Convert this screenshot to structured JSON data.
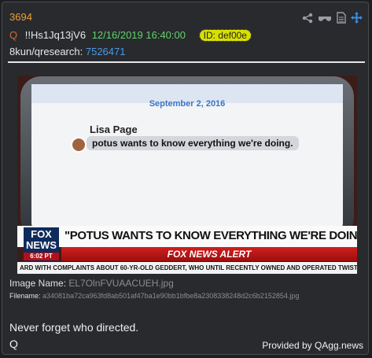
{
  "post": {
    "number": "3694",
    "q_letter": "Q",
    "tripcode": "!!Hs1Jq13jV6",
    "datetime": "12/16/2019 16:40:00",
    "user_id": "ID: def00e",
    "board": "8kun/qresearch:",
    "reference": "7526471"
  },
  "toolbar": {
    "icons": [
      "share-icon",
      "glasses-icon",
      "document-icon",
      "move-icon"
    ]
  },
  "image": {
    "phone_date": "September 2, 2016",
    "sender": "Lisa Page",
    "message": "potus wants to know everything we're doing.",
    "fox_logo": "FOX NEWS",
    "fox_time": "6:02 PT",
    "headline": "\"POTUS WANTS TO KNOW EVERYTHING WE'RE DOING\"",
    "alert": "FOX NEWS ALERT",
    "ticker": "ARD WITH COMPLAINTS ABOUT 60-YR-OLD GEDDERT, WHO UNTIL RECENTLY OWNED AND OPERATED TWIST"
  },
  "meta": {
    "image_name_label": "Image Name:",
    "image_name": "EL7OlnFVUAACUEH.jpg",
    "filename_label": "Filename:",
    "filename": "a34081ba72ca963fd8ab501af47ba1e90bb1bfbe8a2308338248d2c6b2152854.jpg"
  },
  "body": {
    "line1": "Never forget who directed.",
    "line2": "Q"
  },
  "footer": {
    "provided_by": "Provided by QAgg.news"
  }
}
